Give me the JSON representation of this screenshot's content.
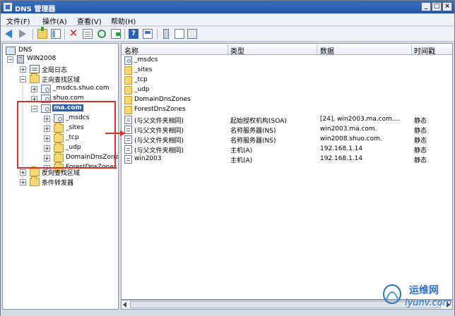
{
  "window": {
    "title": "DNS 管理器"
  },
  "menu": [
    "文件(F)",
    "操作(A)",
    "查看(V)",
    "帮助(H)"
  ],
  "toolbar": [
    "back-icon",
    "forward-icon",
    "up-folder-icon",
    "show-hide-tree-icon",
    "delete-icon",
    "properties-icon",
    "refresh-icon",
    "export-list-icon",
    "help-icon",
    "view-icon",
    "server-icon",
    "document-icon",
    "settings-icon"
  ],
  "tree": [
    {
      "label": "DNS",
      "icon": "dns-icon"
    },
    {
      "label": "WIN2008",
      "icon": "server-icon"
    },
    {
      "label": "全局日志",
      "icon": "log-icon"
    },
    {
      "label": "正向查找区域",
      "icon": "folder-icon"
    },
    {
      "label": "_msdcs.shuo.com",
      "icon": "zone-icon"
    },
    {
      "label": "shuo.com",
      "icon": "zone-icon"
    },
    {
      "label": "ma.com",
      "icon": "zone-icon",
      "selected": true
    },
    {
      "label": "_msdcs",
      "icon": "zone-icon"
    },
    {
      "label": "_sites",
      "icon": "folder-icon"
    },
    {
      "label": "_tcp",
      "icon": "folder-icon"
    },
    {
      "label": "_udp",
      "icon": "folder-icon"
    },
    {
      "label": "DomainDnsZones",
      "icon": "folder-icon"
    },
    {
      "label": "ForestDnsZones",
      "icon": "folder-icon"
    },
    {
      "label": "反向查找区域",
      "icon": "folder-icon"
    },
    {
      "label": "条件转发器",
      "icon": "folder-icon"
    }
  ],
  "columns": [
    "名称",
    "类型",
    "数据",
    "时间戳"
  ],
  "rows": [
    {
      "name": "_msdcs",
      "type": "",
      "data": "",
      "time": "",
      "icon": "zone-icon"
    },
    {
      "name": "_sites",
      "type": "",
      "data": "",
      "time": "",
      "icon": "folder-icon"
    },
    {
      "name": "_tcp",
      "type": "",
      "data": "",
      "time": "",
      "icon": "folder-icon"
    },
    {
      "name": "_udp",
      "type": "",
      "data": "",
      "time": "",
      "icon": "folder-icon"
    },
    {
      "name": "DomainDnsZones",
      "type": "",
      "data": "",
      "time": "",
      "icon": "folder-icon"
    },
    {
      "name": "ForestDnsZones",
      "type": "",
      "data": "",
      "time": "",
      "icon": "folder-icon"
    },
    {
      "name": "(与父文件夹相同)",
      "type": "起始授权机构(SOA)",
      "data": "[24], win2003.ma.com....",
      "time": "静态",
      "icon": "record-icon"
    },
    {
      "name": "(与父文件夹相同)",
      "type": "名称服务器(NS)",
      "data": "win2003.ma.com.",
      "time": "静态",
      "icon": "record-icon"
    },
    {
      "name": "(与父文件夹相同)",
      "type": "名称服务器(NS)",
      "data": "win2008.shuo.com.",
      "time": "静态",
      "icon": "record-icon"
    },
    {
      "name": "(与父文件夹相同)",
      "type": "主机(A)",
      "data": "192.168.1.14",
      "time": "静态",
      "icon": "record-icon"
    },
    {
      "name": "win2003",
      "type": "主机(A)",
      "data": "192.168.1.14",
      "time": "静态",
      "icon": "record-icon"
    }
  ],
  "watermark": {
    "text": "运维网",
    "url": "iyunv.com"
  },
  "colors": {
    "accent": "#2a5db0",
    "annotation": "#d9322a"
  }
}
